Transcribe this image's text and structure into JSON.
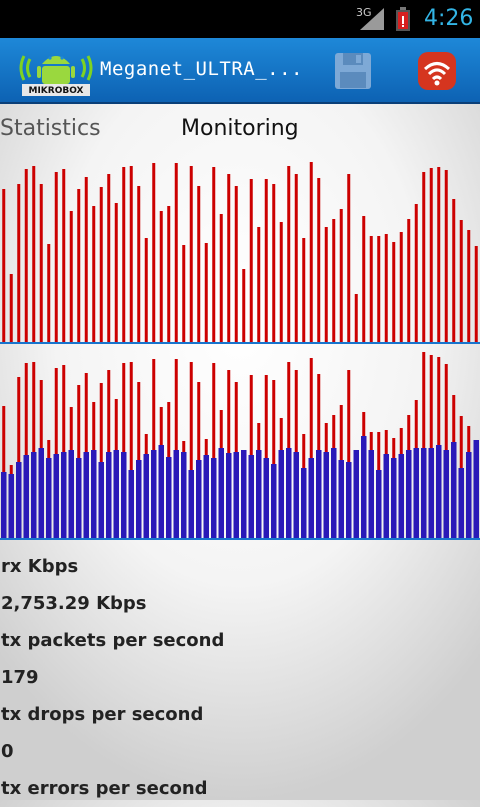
{
  "status_bar": {
    "network": "3G",
    "time": "4:26",
    "signal_icon": "signal-icon",
    "battery_icon": "battery-low-icon"
  },
  "action_bar": {
    "logo_text": "MIKROBOX",
    "title": "Meganet_ULTRA_...",
    "save_icon": "floppy-save-icon",
    "wifi_icon": "wifi-icon"
  },
  "tabs": [
    {
      "label": "Statistics"
    },
    {
      "label": "Monitoring"
    }
  ],
  "colors": {
    "rx": "#cc0000",
    "tx": "#2a19b8",
    "accent": "#33b5e5",
    "bar": "#1874cd"
  },
  "chart_data": [
    {
      "type": "bar",
      "series": [
        {
          "values": [
            155,
            70,
            160,
            175,
            178,
            160,
            100,
            172,
            175,
            133,
            155,
            167,
            138,
            157,
            170,
            141,
            177,
            178,
            158,
            106,
            181,
            133,
            138,
            181,
            99,
            178,
            158,
            101,
            177,
            130,
            170,
            158,
            75,
            165,
            117,
            165,
            160,
            122,
            178,
            170,
            106,
            182,
            166,
            117,
            125,
            135,
            170,
            50,
            128,
            108,
            108,
            110,
            102,
            112,
            125,
            140,
            172,
            176,
            177,
            174,
            145,
            124,
            114,
            98
          ]
        }
      ],
      "ylim": [
        0,
        194
      ]
    },
    {
      "type": "bar",
      "series": [
        {
          "values": [
            134,
            75,
            163,
            177,
            178,
            160,
            100,
            172,
            175,
            133,
            155,
            167,
            138,
            157,
            170,
            141,
            177,
            178,
            158,
            106,
            181,
            133,
            138,
            181,
            99,
            178,
            158,
            101,
            177,
            130,
            170,
            158,
            75,
            165,
            117,
            165,
            160,
            122,
            178,
            170,
            106,
            182,
            166,
            117,
            125,
            135,
            170,
            50,
            128,
            108,
            108,
            110,
            102,
            112,
            125,
            140,
            188,
            185,
            183,
            176,
            145,
            124,
            114,
            98
          ]
        },
        {
          "values": [
            68,
            66,
            78,
            85,
            88,
            92,
            82,
            86,
            88,
            90,
            82,
            88,
            90,
            78,
            88,
            90,
            88,
            70,
            80,
            86,
            90,
            95,
            83,
            90,
            88,
            70,
            80,
            85,
            82,
            92,
            87,
            88,
            90,
            85,
            90,
            82,
            76,
            90,
            92,
            88,
            72,
            82,
            90,
            88,
            92,
            80,
            78,
            90,
            104,
            90,
            70,
            86,
            82,
            86,
            90,
            92,
            92,
            92,
            95,
            90,
            98,
            72,
            88,
            100
          ]
        }
      ],
      "ylim": [
        0,
        196
      ]
    }
  ],
  "stats": {
    "rx_label": "rx Kbps",
    "rx_value": "2,753.29 Kbps",
    "tx_pps_label": "tx packets per second",
    "tx_pps_value": "179",
    "tx_drops_label": "tx drops per second",
    "tx_drops_value": "0",
    "tx_errors_label": "tx errors per second"
  }
}
